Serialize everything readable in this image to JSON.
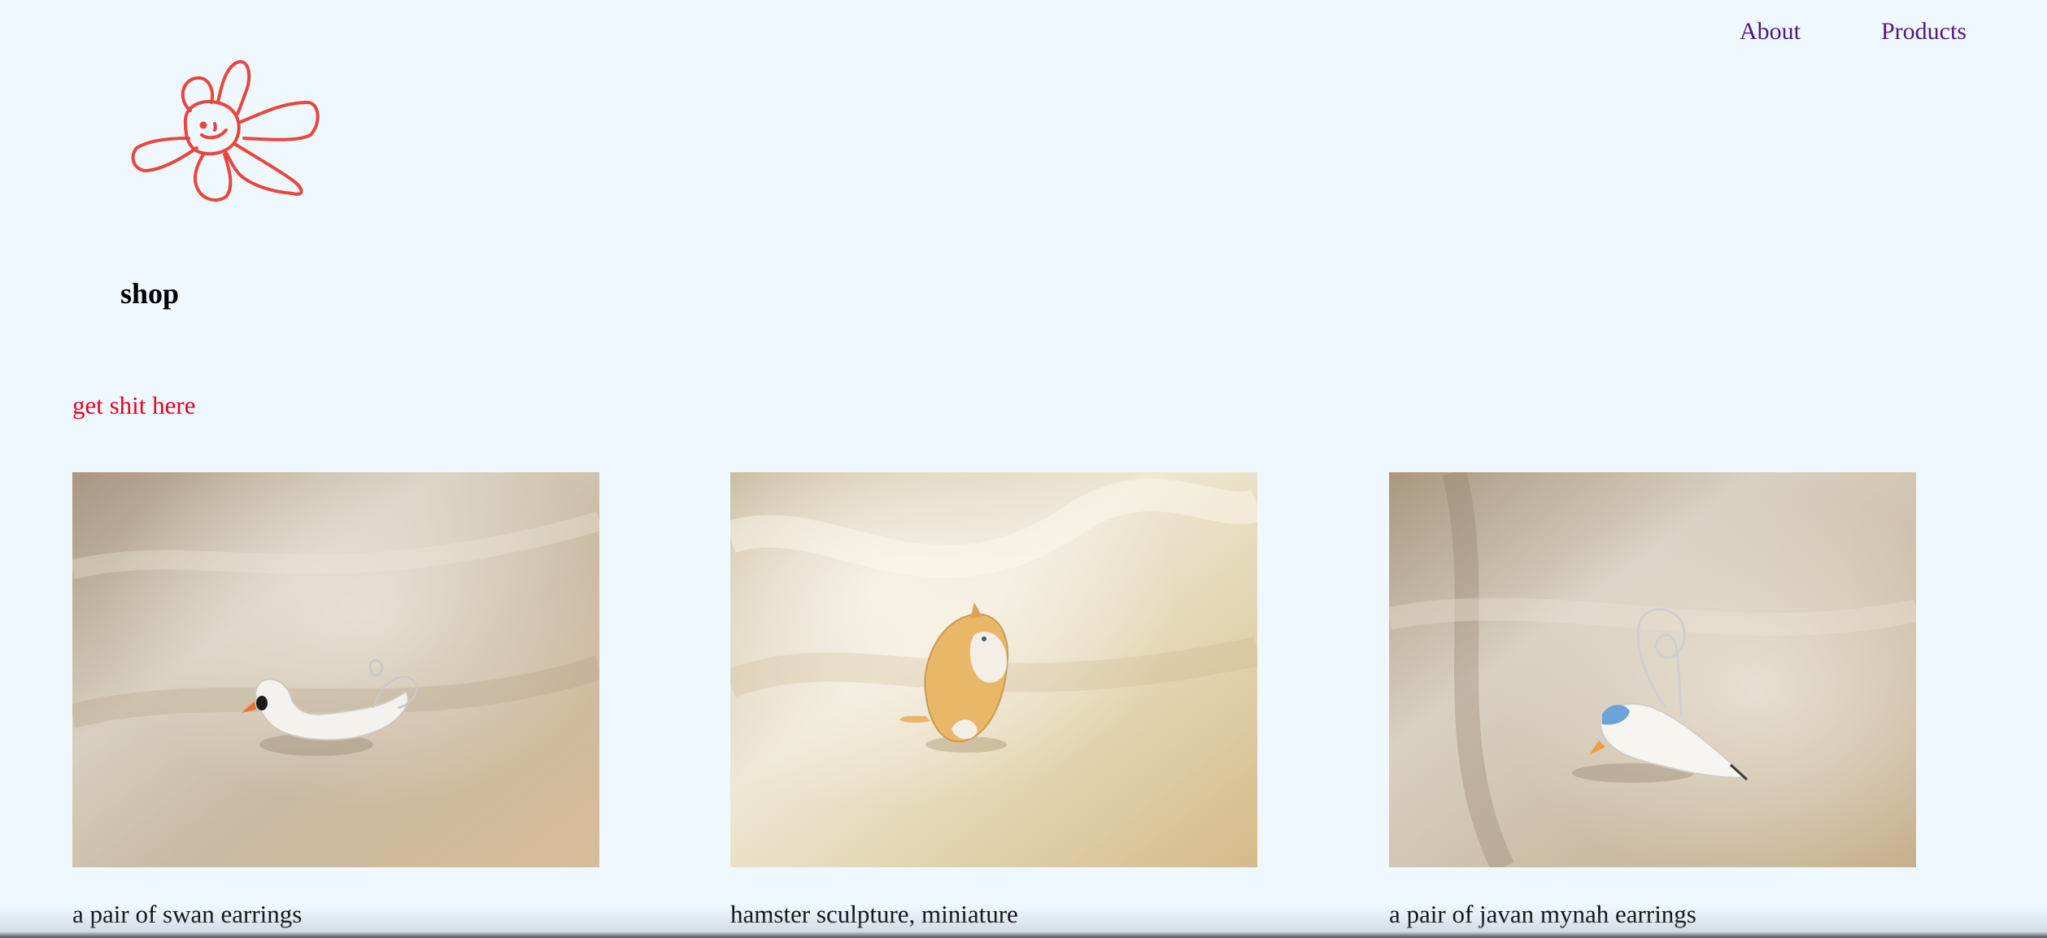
{
  "nav": {
    "about_label": "About",
    "products_label": "Products"
  },
  "header": {
    "logo_icon": "hand-drawn-flower-face-logo",
    "title": "shop",
    "tagline": "get shit here"
  },
  "products": [
    {
      "caption": "a pair of swan earrings",
      "image": "swan-earring-photo"
    },
    {
      "caption": "hamster sculpture, miniature",
      "image": "hamster-sculpture-photo"
    },
    {
      "caption": "a pair of javan mynah earrings",
      "image": "javan-mynah-earring-photo"
    }
  ],
  "colors": {
    "background": "#f0f8ff",
    "nav_link": "#4b1a80",
    "tagline": "#e8001c",
    "logo_stroke": "#e8453c"
  }
}
